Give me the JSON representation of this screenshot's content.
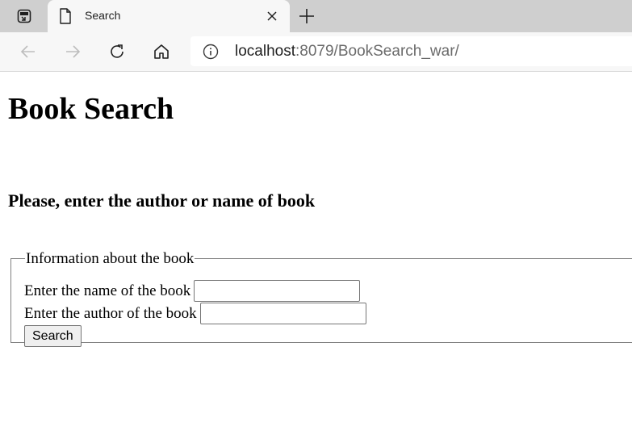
{
  "browser": {
    "tab": {
      "title": "Search"
    },
    "address_bar": {
      "host": "localhost",
      "rest": ":8079/BookSearch_war/"
    }
  },
  "page": {
    "heading": "Book Search",
    "subheading": "Please, enter the author or name of book",
    "form": {
      "legend": "Information about the book",
      "name_label": "Enter the name of the book",
      "name_value": "",
      "author_label": "Enter the author of the book",
      "author_value": "",
      "submit_label": "Search"
    }
  }
}
